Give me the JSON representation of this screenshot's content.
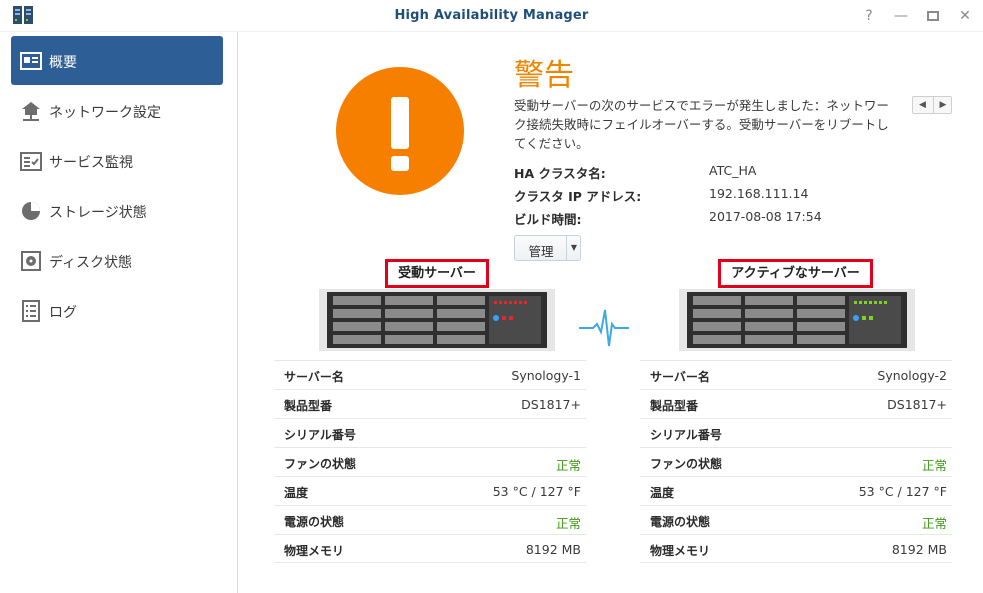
{
  "window": {
    "title": "High Availability Manager"
  },
  "sidebar": {
    "items": [
      {
        "label": "概要",
        "icon": "overview-icon",
        "active": true
      },
      {
        "label": "ネットワーク設定",
        "icon": "network-icon"
      },
      {
        "label": "サービス監視",
        "icon": "service-monitor-icon"
      },
      {
        "label": "ストレージ状態",
        "icon": "storage-icon"
      },
      {
        "label": "ディスク状態",
        "icon": "disk-icon"
      },
      {
        "label": "ログ",
        "icon": "log-icon"
      }
    ]
  },
  "status": {
    "title": "警告",
    "message": "受動サーバーの次のサービスでエラーが発生しました：ネットワーク接続失敗時にフェイルオーバーする。受動サーバーをリブートしてください。",
    "color": "#f77f00"
  },
  "info": {
    "cluster_name_label": "HA クラスタ名:",
    "cluster_name": "ATC_HA",
    "cluster_ip_label": "クラスタ IP アドレス:",
    "cluster_ip": "192.168.111.14",
    "build_time_label": "ビルド時間:",
    "build_time": "2017-08-08 17:54"
  },
  "manage_button": {
    "label": "管理"
  },
  "servers": {
    "passive": {
      "label": "受動サーバー",
      "rows": [
        {
          "key": "サーバー名",
          "value": "Synology-1"
        },
        {
          "key": "製品型番",
          "value": "DS1817+"
        },
        {
          "key": "シリアル番号",
          "value": ""
        },
        {
          "key": "ファンの状態",
          "value": "正常"
        },
        {
          "key": "温度",
          "value": "53 °C / 127 °F"
        },
        {
          "key": "電源の状態",
          "value": "正常"
        },
        {
          "key": "物理メモリ",
          "value": "8192 MB"
        }
      ]
    },
    "active": {
      "label": "アクティブなサーバー",
      "rows": [
        {
          "key": "サーバー名",
          "value": "Synology-2"
        },
        {
          "key": "製品型番",
          "value": "DS1817+"
        },
        {
          "key": "シリアル番号",
          "value": ""
        },
        {
          "key": "ファンの状態",
          "value": "正常"
        },
        {
          "key": "温度",
          "value": "53 °C / 127 °F"
        },
        {
          "key": "電源の状態",
          "value": "正常"
        },
        {
          "key": "物理メモリ",
          "value": "8192 MB"
        }
      ]
    }
  },
  "colors": {
    "accent": "#2d5e95",
    "warning": "#f08300",
    "ok": "#3e9a16",
    "highlight_border": "#e3001b"
  }
}
